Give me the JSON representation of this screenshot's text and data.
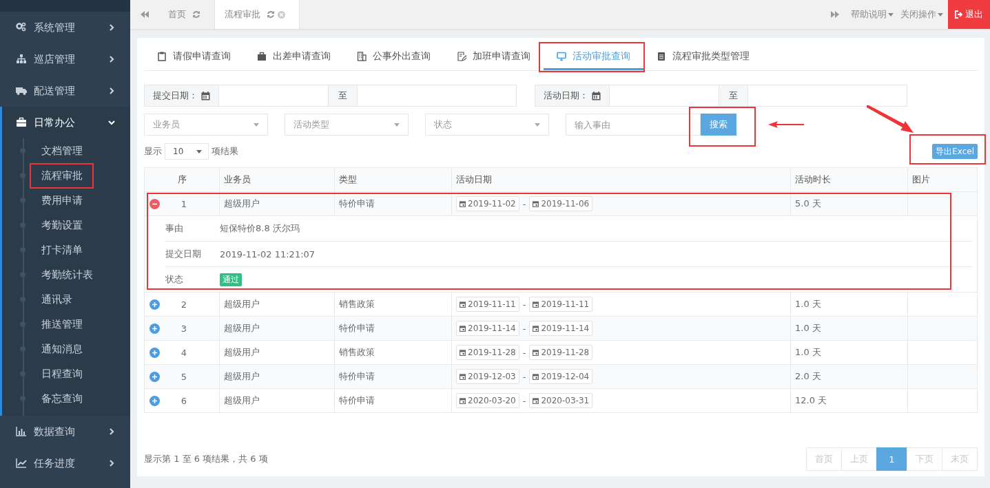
{
  "sidebar": {
    "items": [
      {
        "label": "系统管理",
        "expanded": false
      },
      {
        "label": "巡店管理",
        "expanded": false
      },
      {
        "label": "配送管理",
        "expanded": false
      },
      {
        "label": "日常办公",
        "expanded": true,
        "children": [
          {
            "label": "文档管理",
            "annotated": false
          },
          {
            "label": "流程审批",
            "annotated": true
          },
          {
            "label": "费用申请",
            "annotated": false
          },
          {
            "label": "考勤设置",
            "annotated": false
          },
          {
            "label": "打卡清单",
            "annotated": false
          },
          {
            "label": "考勤统计表",
            "annotated": false
          },
          {
            "label": "通讯录",
            "annotated": false
          },
          {
            "label": "推送管理",
            "annotated": false
          },
          {
            "label": "通知消息",
            "annotated": false
          },
          {
            "label": "日程查询",
            "annotated": false
          },
          {
            "label": "备忘查询",
            "annotated": false
          }
        ]
      },
      {
        "label": "数据查询",
        "expanded": false
      },
      {
        "label": "任务进度",
        "expanded": false
      }
    ]
  },
  "top_bar": {
    "tabs": [
      {
        "label": "首页",
        "selected": false,
        "closable": false
      },
      {
        "label": "流程审批",
        "selected": true,
        "closable": true
      }
    ],
    "menus": [
      "帮助说明",
      "关闭操作"
    ],
    "logout": "退出"
  },
  "sub_tabs": [
    {
      "label": "请假申请查询",
      "selected": false,
      "annotated": false
    },
    {
      "label": "出差申请查询",
      "selected": false,
      "annotated": false
    },
    {
      "label": "公事外出查询",
      "selected": false,
      "annotated": false
    },
    {
      "label": "加班申请查询",
      "selected": false,
      "annotated": false
    },
    {
      "label": "活动审批查询",
      "selected": true,
      "annotated": true
    },
    {
      "label": "流程审批类型管理",
      "selected": false,
      "annotated": false
    }
  ],
  "filters": {
    "date_ranges": [
      {
        "label": "提交日期：",
        "separator": "至"
      },
      {
        "label": "活动日期：",
        "separator": "至"
      }
    ],
    "selects": [
      {
        "placeholder": "业务员"
      },
      {
        "placeholder": "活动类型"
      },
      {
        "placeholder": "状态"
      }
    ],
    "reason": {
      "placeholder": "输入事由"
    },
    "search_button": {
      "label": "搜索",
      "annotated": true,
      "arrow": true
    }
  },
  "page_length": {
    "prefix": "显示",
    "value": "10",
    "suffix": "项结果"
  },
  "export_button": {
    "label": "导出Excel",
    "annotated": true,
    "arrow": true
  },
  "table": {
    "columns": [
      "序",
      "业务员",
      "类型",
      "活动日期",
      "活动时长",
      "图片"
    ],
    "rows": [
      {
        "index": "1",
        "user": "超级用户",
        "type": "特价申请",
        "date_from": "2019-11-02",
        "date_sep": "-",
        "date_to": "2019-11-06",
        "duration": "5.0 天",
        "expanded": true,
        "annotated": true,
        "details": [
          {
            "label": "事由",
            "value": "短保特价8.8 沃尔玛",
            "kind": "text"
          },
          {
            "label": "提交日期",
            "value": "2019-11-02 11:21:07",
            "kind": "text"
          },
          {
            "label": "状态",
            "value": "通过",
            "kind": "badge"
          }
        ]
      },
      {
        "index": "2",
        "user": "超级用户",
        "type": "销售政策",
        "date_from": "2019-11-11",
        "date_sep": "-",
        "date_to": "2019-11-11",
        "duration": "1.0 天",
        "expanded": false,
        "annotated": false
      },
      {
        "index": "3",
        "user": "超级用户",
        "type": "特价申请",
        "date_from": "2019-11-14",
        "date_sep": "-",
        "date_to": "2019-11-14",
        "duration": "1.0 天",
        "expanded": false,
        "annotated": false
      },
      {
        "index": "4",
        "user": "超级用户",
        "type": "销售政策",
        "date_from": "2019-11-28",
        "date_sep": "-",
        "date_to": "2019-11-28",
        "duration": "1.0 天",
        "expanded": false,
        "annotated": false
      },
      {
        "index": "5",
        "user": "超级用户",
        "type": "特价申请",
        "date_from": "2019-12-03",
        "date_sep": "-",
        "date_to": "2019-12-04",
        "duration": "2.0 天",
        "expanded": false,
        "annotated": false
      },
      {
        "index": "6",
        "user": "超级用户",
        "type": "特价申请",
        "date_from": "2020-03-20",
        "date_sep": "-",
        "date_to": "2020-03-31",
        "duration": "12.0 天",
        "expanded": false,
        "annotated": false
      }
    ]
  },
  "footer": {
    "info": "显示第 1 至 6 项结果，共 6 项",
    "pagination": [
      {
        "label": "首页",
        "selected": false,
        "disabled": true
      },
      {
        "label": "上页",
        "selected": false,
        "disabled": true
      },
      {
        "label": "1",
        "selected": true,
        "disabled": false
      },
      {
        "label": "下页",
        "selected": false,
        "disabled": true
      },
      {
        "label": "末页",
        "selected": false,
        "disabled": true
      }
    ]
  }
}
